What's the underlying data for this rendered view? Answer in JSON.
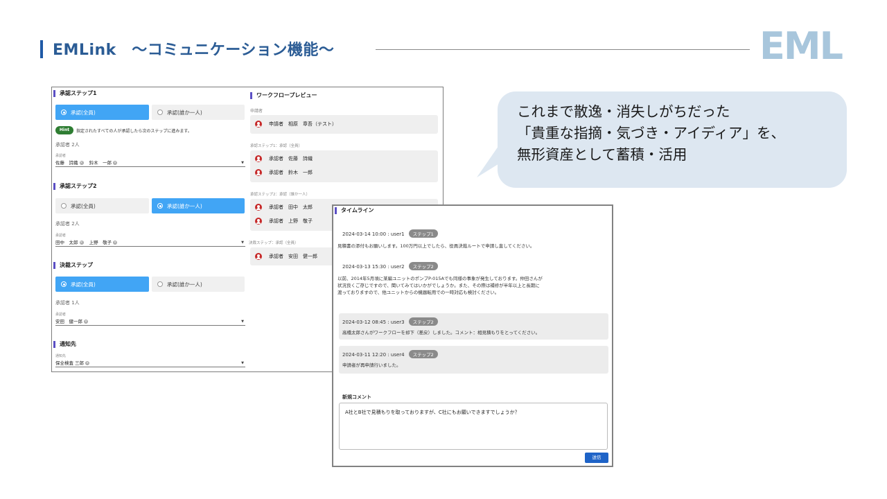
{
  "header": {
    "title": "EMLink　～コミュニケーション機能～",
    "logo": "EML"
  },
  "bubble": {
    "lines": [
      "これまで散逸・消失しがちだった",
      "「貴重な指摘・気づき・アイディア」を、",
      "無形資産として蓄積・活用"
    ]
  },
  "form": {
    "step1": {
      "title": "承認ステップ1",
      "opt_all": "承認(全員)",
      "opt_one": "承認(誰か一人)",
      "hint_label": "Hint",
      "hint_text": "指定されたすべての人が承認したら次のステップに進みます。",
      "count": "承認者 2人",
      "field_label": "承認者",
      "chips": [
        "佐藤　詩織",
        "鈴木　一郎"
      ]
    },
    "step2": {
      "title": "承認ステップ2",
      "opt_all": "承認(全員)",
      "opt_one": "承認(誰か一人)",
      "count": "承認者 2人",
      "field_label": "承認者",
      "chips": [
        "田中　太郎",
        "上野　敬子"
      ]
    },
    "final": {
      "title": "決裁ステップ",
      "opt_all": "承認(全員)",
      "opt_one": "承認(誰か一人)",
      "count": "承認者 1人",
      "field_label": "承認者",
      "chips": [
        "安田　健一郎"
      ]
    },
    "notify": {
      "title": "通知先",
      "field_label": "通知先",
      "chips": [
        "保全検査 三郎"
      ]
    }
  },
  "preview": {
    "title": "ワークフロープレビュー",
    "applicant_label": "申請者",
    "applicant": "申請者　相原　章吾（テスト）",
    "s1_label": "承認ステップ1：承認（全員）",
    "s1": [
      "承認者　佐藤　詩織",
      "承認者　鈴木　一郎"
    ],
    "s2_label": "承認ステップ2：承認（誰か一人）",
    "s2": [
      "承認者　田中　太郎",
      "承認者　上野　敬子"
    ],
    "final_label": "決裁ステップ：承認（全員）",
    "final": [
      "承認者　安田　健一郎"
    ]
  },
  "timeline": {
    "title": "タイムライン",
    "entries": [
      {
        "meta": "2024-03-14 10:00 : user1",
        "tag": "ステップ1",
        "text": "見積書の添付もお願いします。100万円以上でしたら、役員決裁ルートで申請し直してください。"
      },
      {
        "meta": "2024-03-13 15:30 : user2",
        "tag": "ステップ2",
        "text1": "以前、2014年5月頃に某編ユニットのポンプP-015Aでも同様の事象が発生しております。仲田さんが",
        "text2": "状況良くご存じですので、聞いてみてはいかがでしょうか。また、その際は補修が半年以上と長期に",
        "text3": "渡っておりますので、他ユニットからの機器転用での一時対応も検討ください。"
      },
      {
        "meta": "2024-03-12 08:45 : user3",
        "tag": "ステップ2",
        "text": "高橋太郎さんがワークフローを却下（差戻）しました。コメント：相見積もりをとってください。"
      },
      {
        "meta": "2024-03-11 12:20 : user4",
        "tag": "ステップ2",
        "text": "申請者が再申請行いました。"
      }
    ],
    "new_comment_label": "新規コメント",
    "comment_value": "A社とB社で見積もりを取っておりますが、C社にもお願いできますでしょうか？",
    "send_label": "送信"
  },
  "colors": {
    "accent": "#41a5f5",
    "title": "#2b5c95",
    "bubble": "#dde7f1",
    "send": "#1e63c7"
  }
}
